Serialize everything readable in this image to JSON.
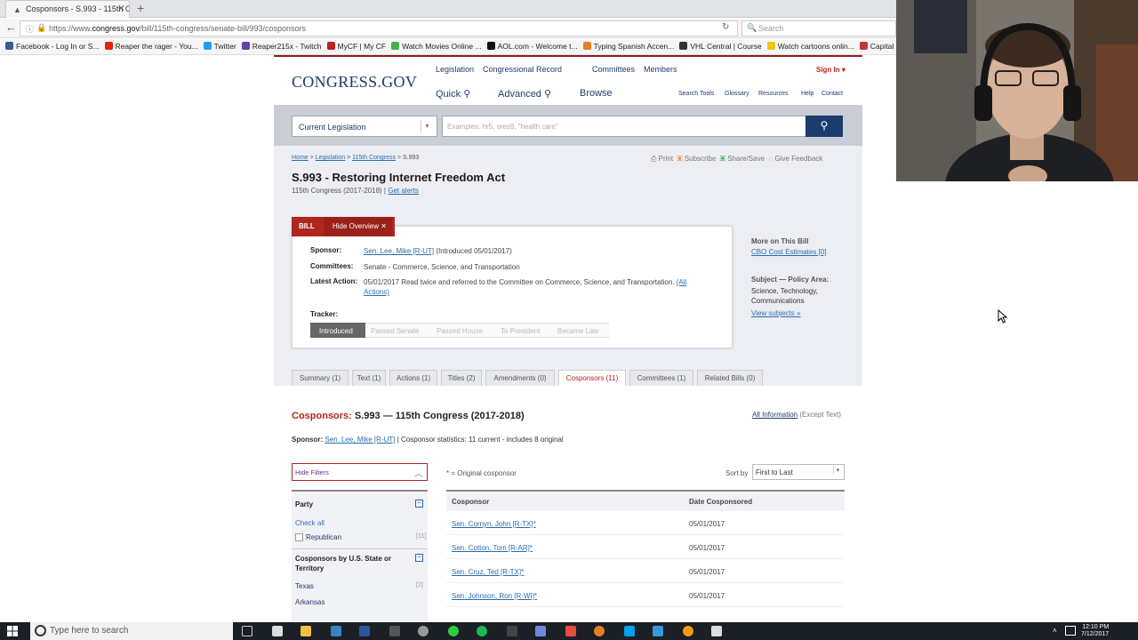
{
  "browser": {
    "tab_title": "Cosponsors - S.993 - 115th C",
    "url_prefix": "https://www.",
    "url_host": "congress.gov",
    "url_path": "/bill/115th-congress/senate-bill/993/cosponsors",
    "search_placeholder": "Search",
    "bookmarks": [
      {
        "label": "Facebook - Log In or S...",
        "color": "#3b5998"
      },
      {
        "label": "Reaper the rager - You...",
        "color": "#e62117"
      },
      {
        "label": "Twitter",
        "color": "#1da1f2"
      },
      {
        "label": "Reaper215x - Twitch",
        "color": "#6441a4"
      },
      {
        "label": "MyCF | My CF",
        "color": "#b22"
      },
      {
        "label": "Watch Movies Online ...",
        "color": "#4caf50"
      },
      {
        "label": "AOL.com - Welcome t...",
        "color": "#111"
      },
      {
        "label": "Typing Spanish Accen...",
        "color": "#e67e22"
      },
      {
        "label": "VHL Central | Course",
        "color": "#333"
      },
      {
        "label": "Watch cartoons onlin...",
        "color": "#f1c40f"
      },
      {
        "label": "Capital One Onlin",
        "color": "#c0392b"
      }
    ]
  },
  "site": {
    "logo_a": "CONGRESS",
    "logo_dot": ".",
    "logo_b": "GOV",
    "topnav": [
      "Legislation",
      "Congressional Record",
      "Committees",
      "Members"
    ],
    "sign_in": "Sign In ▾",
    "quick": "Quick",
    "advanced": "Advanced",
    "browse": "Browse",
    "tools": [
      "Search Tools",
      "Glossary",
      "Resources",
      "Help",
      "Contact"
    ],
    "collection": "Current Legislation",
    "search_placeholder": "Examples: hr5, sres9, \"health care\""
  },
  "bill": {
    "breadcrumbs": [
      "Home",
      "Legislation",
      "115th Congress",
      "S.993"
    ],
    "actions": [
      "Print",
      "Subscribe",
      "Share/Save",
      "Give Feedback"
    ],
    "title": "S.993 - Restoring Internet Freedom Act",
    "congress": "115th Congress (2017-2018)",
    "get_alerts": "Get alerts",
    "tag": "BILL",
    "hide_overview": "Hide Overview ✕",
    "sponsor_label": "Sponsor:",
    "sponsor_name": "Sen. Lee, Mike [R-UT]",
    "sponsor_intro": "(Introduced 05/01/2017)",
    "committees_label": "Committees:",
    "committees_value": "Senate - Commerce, Science, and Transportation",
    "latest_label": "Latest Action:",
    "latest_value": "05/01/2017 Read twice and referred to the Committee on Commerce, Science, and Transportation.",
    "all_actions": "(All Actions)",
    "tracker_label": "Tracker:",
    "tracker": [
      "Introduced",
      "Passed Senate",
      "Passed House",
      "To President",
      "Became Law"
    ],
    "more_title": "More on This Bill",
    "cbo": "CBO Cost Estimates [0]",
    "subject_title": "Subject — Policy Area:",
    "subject_value": "Science, Technology, Communications",
    "view_subjects": "View subjects »"
  },
  "tabs": [
    "Summary (1)",
    "Text (1)",
    "Actions (1)",
    "Titles (2)",
    "Amendments (0)",
    "Cosponsors (11)",
    "Committees (1)",
    "Related Bills (0)"
  ],
  "cosponsors": {
    "heading_red": "Cosponsors:",
    "heading_rest": "S.993 — 115th Congress (2017-2018)",
    "all_info": "All Information",
    "except_text": "(Except Text)",
    "sponsor_label": "Sponsor:",
    "sponsor_name": "Sen. Lee, Mike [R-UT]",
    "stats": "| Cosponsor statistics: 11 current - includes 8 original",
    "hide_filters": "Hide Filters",
    "original_note": "* = Original cosponsor",
    "sort_label": "Sort by",
    "sort_value": "First to Last",
    "col_cosponsor": "Cosponsor",
    "col_date": "Date Cosponsored",
    "rows": [
      {
        "name": "Sen. Cornyn, John [R-TX]*",
        "date": "05/01/2017"
      },
      {
        "name": "Sen. Cotton, Tom [R-AR]*",
        "date": "05/01/2017"
      },
      {
        "name": "Sen. Cruz, Ted [R-TX]*",
        "date": "05/01/2017"
      },
      {
        "name": "Sen. Johnson, Ron [R-WI]*",
        "date": "05/01/2017"
      }
    ],
    "filters": {
      "party_title": "Party",
      "check_all": "Check all",
      "republican": "Republican",
      "republican_count": "[11]",
      "state_title": "Cosponsors by U.S. State or Territory",
      "texas": "Texas",
      "texas_count": "[2]",
      "arkansas": "Arkansas"
    }
  },
  "taskbar": {
    "search_placeholder": "Type here to search",
    "time": "12:10 PM",
    "date": "7/12/2017"
  },
  "colors": {
    "brand_red": "#b0261e",
    "brand_navy": "#1d3c6e",
    "link": "#2b6cb0"
  }
}
